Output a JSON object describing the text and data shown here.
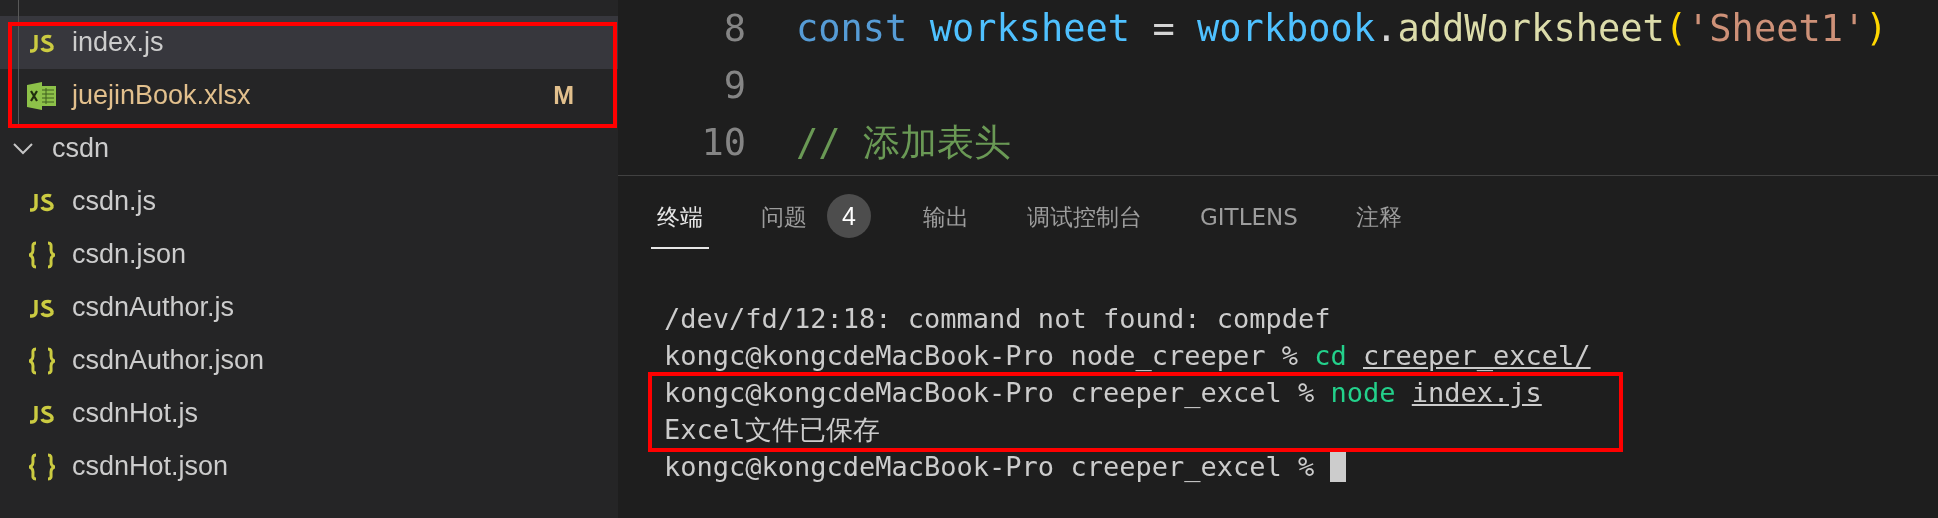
{
  "sidebar": {
    "items": [
      {
        "kind": "js",
        "name": "index.js",
        "selected": true
      },
      {
        "kind": "excel",
        "name": "juejinBook.xlsx",
        "selected": false,
        "badge": "M"
      },
      {
        "kind": "folder",
        "name": "csdn",
        "expanded": true,
        "selected": false,
        "children": [
          {
            "kind": "js",
            "name": "csdn.js",
            "selected": false
          },
          {
            "kind": "json",
            "name": "csdn.json",
            "selected": false
          },
          {
            "kind": "js",
            "name": "csdnAuthor.js",
            "selected": false
          },
          {
            "kind": "json",
            "name": "csdnAuthor.json",
            "selected": false
          },
          {
            "kind": "js",
            "name": "csdnHot.js",
            "selected": false
          },
          {
            "kind": "json",
            "name": "csdnHot.json",
            "selected": false
          }
        ]
      }
    ]
  },
  "editor": {
    "lines": [
      {
        "number": "8",
        "tokens": [
          {
            "kind": "keyword",
            "text": "const "
          },
          {
            "kind": "variable",
            "text": "worksheet"
          },
          {
            "kind": "plain",
            "text": " = "
          },
          {
            "kind": "variable",
            "text": "workbook"
          },
          {
            "kind": "plain",
            "text": "."
          },
          {
            "kind": "function",
            "text": "addWorksheet"
          },
          {
            "kind": "bracket",
            "text": "("
          },
          {
            "kind": "string",
            "text": "'Sheet1'"
          },
          {
            "kind": "bracket",
            "text": ")"
          }
        ]
      },
      {
        "number": "9"
      },
      {
        "number": "10",
        "tokens": [
          {
            "kind": "comment",
            "text": "// 添加表头"
          }
        ]
      }
    ]
  },
  "panel": {
    "tabs": [
      {
        "label": "终端",
        "selected": true
      },
      {
        "label": "问题",
        "selected": false,
        "badge": "4"
      },
      {
        "label": "输出",
        "selected": false
      },
      {
        "label": "调试控制台",
        "selected": false
      },
      {
        "label": "GITLENS",
        "selected": false
      },
      {
        "label": "注释",
        "selected": false
      }
    ],
    "terminal": {
      "lines": [
        {
          "segments": [
            {
              "kind": "plain",
              "text": "/dev/fd/12:18: command not found: compdef"
            }
          ]
        },
        {
          "segments": [
            {
              "kind": "plain",
              "text": "kongc@kongcdeMacBook-Pro node_creeper % "
            },
            {
              "kind": "command",
              "text": "cd "
            },
            {
              "kind": "path",
              "text": "creeper_excel/"
            }
          ]
        },
        {
          "segments": [
            {
              "kind": "plain",
              "text": "kongc@kongcdeMacBook-Pro creeper_excel % "
            },
            {
              "kind": "command",
              "text": "node "
            },
            {
              "kind": "path",
              "text": "index.js"
            }
          ]
        },
        {
          "segments": [
            {
              "kind": "plain",
              "text": "Excel文件已保存"
            }
          ]
        },
        {
          "segments": [
            {
              "kind": "plain",
              "text": "kongc@kongcdeMacBook-Pro creeper_excel % "
            }
          ],
          "cursor": true
        }
      ]
    }
  }
}
